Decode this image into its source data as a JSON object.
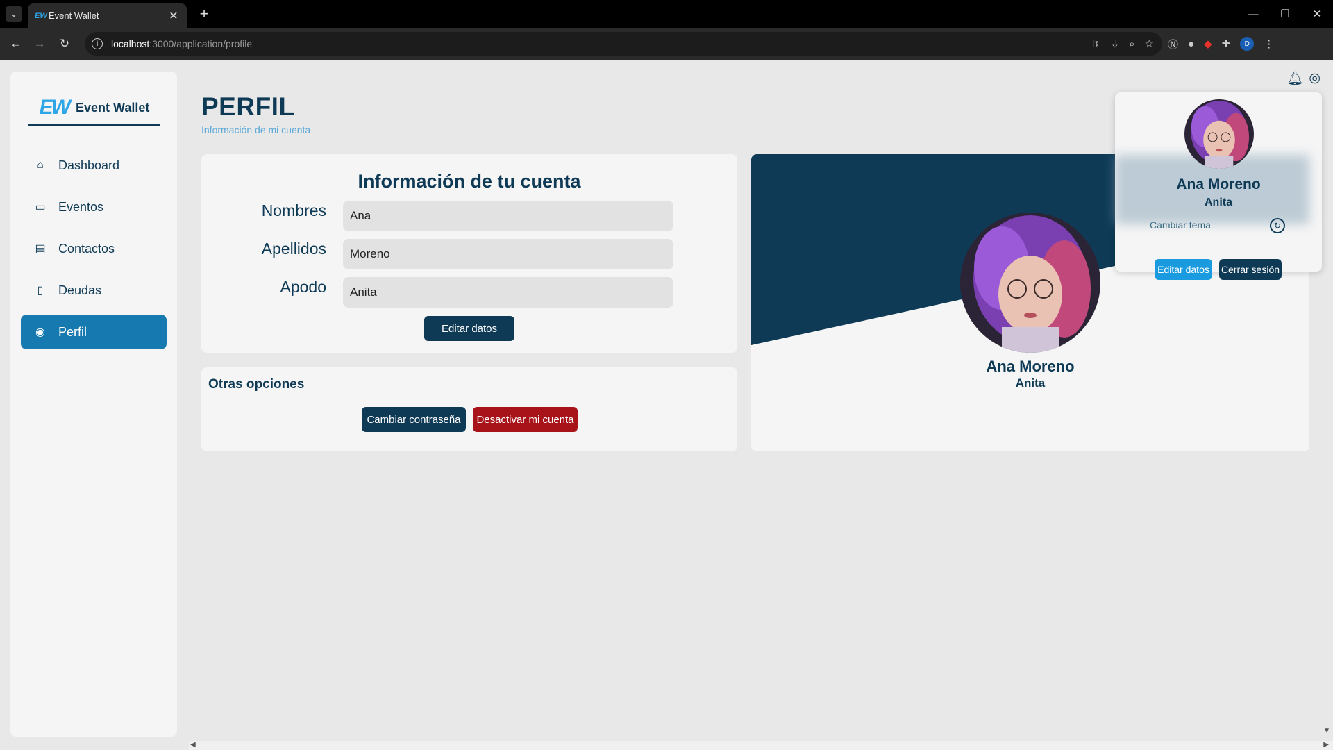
{
  "browser": {
    "tab_title": "Event Wallet",
    "tab_favicon": "EW",
    "url_host": "localhost",
    "url_path": ":3000/application/profile",
    "profile_initial": "D"
  },
  "brand": {
    "logo": "EW",
    "name": "Event Wallet"
  },
  "sidebar": {
    "items": [
      {
        "label": "Dashboard",
        "icon": "home-icon",
        "glyph": "⌂",
        "active": false
      },
      {
        "label": "Eventos",
        "icon": "calendar-icon",
        "glyph": "▭",
        "active": false
      },
      {
        "label": "Contactos",
        "icon": "contacts-icon",
        "glyph": "▤",
        "active": false
      },
      {
        "label": "Deudas",
        "icon": "receipt-icon",
        "glyph": "▯",
        "active": false
      },
      {
        "label": "Perfil",
        "icon": "user-circle-icon",
        "glyph": "◉",
        "active": true
      }
    ]
  },
  "page": {
    "title": "PERFIL",
    "subtitle": "Información de mi cuenta"
  },
  "account_card": {
    "title": "Información de tu cuenta",
    "fields": [
      {
        "label": "Nombres",
        "value": "Ana"
      },
      {
        "label": "Apellidos",
        "value": "Moreno"
      },
      {
        "label": "Apodo",
        "value": "Anita"
      }
    ],
    "edit_button": "Editar datos"
  },
  "options_card": {
    "title": "Otras opciones",
    "change_password": "Cambiar contraseña",
    "deactivate": "Desactivar mi cuenta"
  },
  "profile_card": {
    "name": "Ana Moreno",
    "nickname": "Anita"
  },
  "dropdown": {
    "name": "Ana Moreno",
    "nickname": "Anita",
    "theme_label": "Cambiar tema",
    "edit_button": "Editar datos",
    "logout_button": "Cerrar sesión"
  },
  "colors": {
    "primary": "#0e3a56",
    "accent": "#167ab0",
    "danger": "#a8131a",
    "light_blue": "#1a9be0"
  }
}
